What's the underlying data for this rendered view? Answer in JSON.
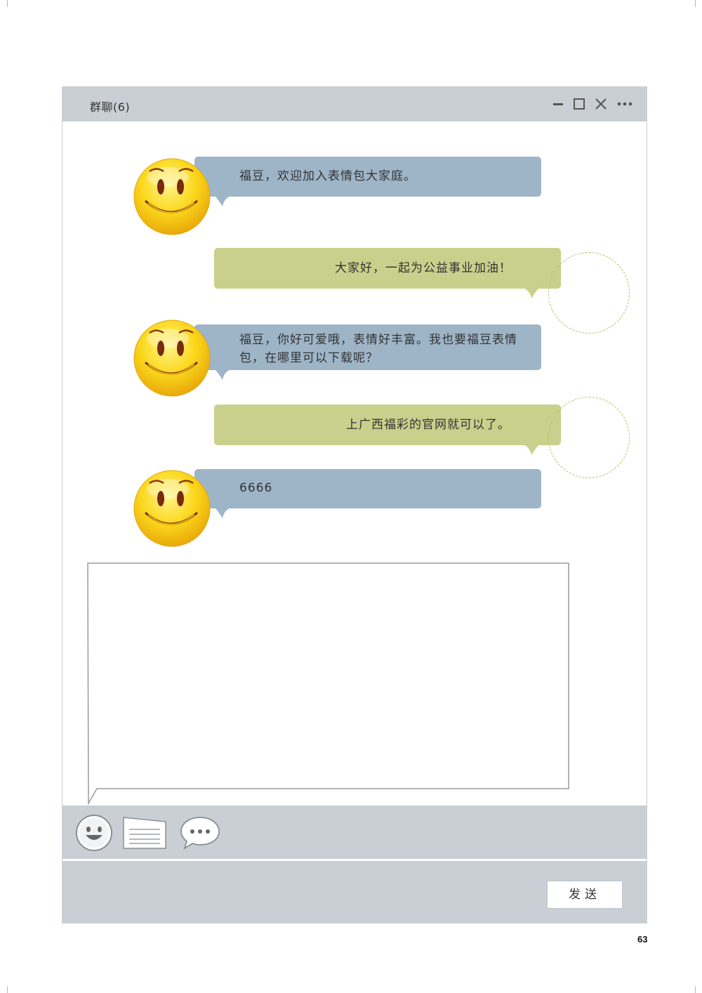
{
  "window": {
    "title": "群聊(6)"
  },
  "controls": {
    "minimize": "minimize-icon",
    "maximize": "maximize-icon",
    "close": "close-icon",
    "more": "more-icon"
  },
  "messages": [
    {
      "side": "left",
      "text": "福豆，欢迎加入表情包大家庭。"
    },
    {
      "side": "right",
      "text": "大家好，一起为公益事业加油！"
    },
    {
      "side": "left",
      "text": "福豆，你好可爱哦，表情好丰富。我也要福豆表情包，在哪里可以下载呢？"
    },
    {
      "side": "right",
      "text": "上广西福彩的官网就可以了。"
    },
    {
      "side": "left",
      "text": "6666"
    }
  ],
  "input": {
    "value": ""
  },
  "toolbar": {
    "emoji": "emoji-icon",
    "file": "file-icon",
    "chat": "chat-bubble-icon"
  },
  "footer": {
    "send_label": "发送"
  },
  "page": {
    "number": "63"
  },
  "colors": {
    "left_bubble": "#9eb5c8",
    "right_bubble": "#c9d08b",
    "chrome": "#c9cfd4"
  }
}
